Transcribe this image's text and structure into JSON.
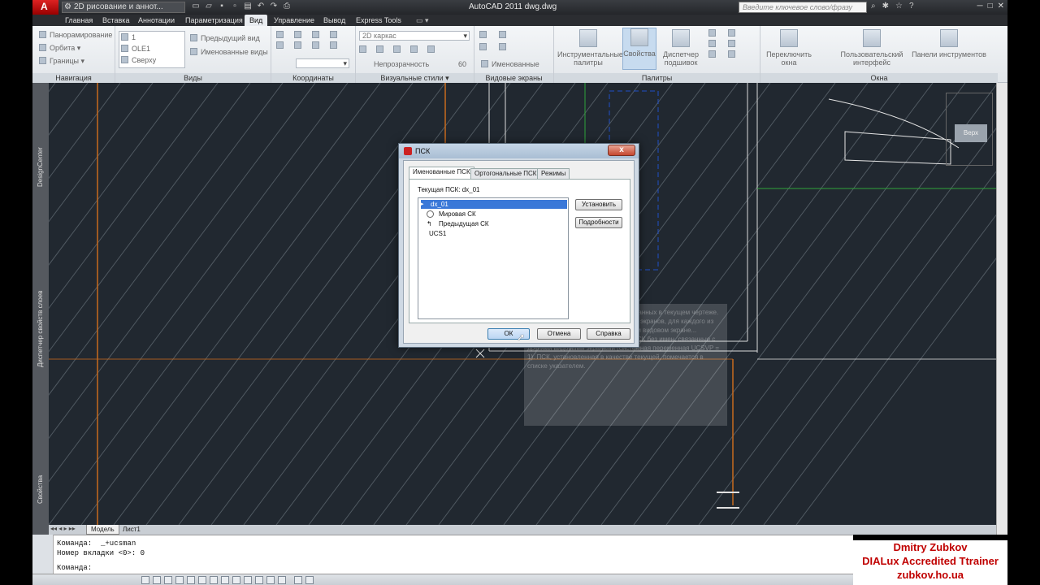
{
  "window": {
    "app_title": "AutoCAD 2011    dwg.dwg",
    "workspace": "2D рисование и аннот...",
    "search_placeholder": "Введите ключевое слово/фразу",
    "logo_letter": "A"
  },
  "menu_tabs": [
    "Главная",
    "Вставка",
    "Аннотации",
    "Параметризация",
    "Вид",
    "Управление",
    "Вывод",
    "Express Tools"
  ],
  "active_tab": "Вид",
  "ribbon": {
    "navigation": {
      "title": "Навигация",
      "items": [
        "Панорамирование",
        "Орбита ▾",
        "Границы ▾"
      ]
    },
    "views": {
      "title": "Виды",
      "list": [
        "1",
        "OLE1",
        "Сверху"
      ],
      "items": [
        "Предыдущий вид",
        "Именованные виды"
      ]
    },
    "coordinates": {
      "title": "Координаты"
    },
    "visual_styles": {
      "title": "Визуальные стили ▾",
      "style_combo": "2D каркас",
      "transparency_label": "Непрозрачность",
      "transparency_value": "60"
    },
    "viewports": {
      "title": "Видовые экраны",
      "named": "Именованные"
    },
    "palettes": {
      "title": "Палитры",
      "tool_palettes": [
        "Инструментальные",
        "палитры"
      ],
      "properties": "Свойства",
      "sheet_set": [
        "Диспетчер",
        "подшивок"
      ]
    },
    "windows": {
      "title": "Окна",
      "switch": [
        "Переключить",
        "окна"
      ],
      "user_interface": [
        "Пользовательский",
        "интерфейс"
      ],
      "toolbars": "Панели инструментов"
    }
  },
  "side_palettes": [
    "DesignCenter",
    "Диспетчер свойств слоев",
    "Свойства"
  ],
  "view_cube_label": "Верх",
  "layout_tabs": [
    "Модель",
    "Лист1"
  ],
  "command_line": {
    "line1": "Команда:  _+ucsman",
    "line2": "Номер вкладки <0>: 0",
    "prompt": "Команда:"
  },
  "tooltip": {
    "text": "Вывод списка систем координат, заданных в текущем чертеже. Если существует несколько видовых экранов, для каждого из них... Именованные ПСК... в текущем видовом экране... Приписанные ПСК... определения ПСК без имен, связанные с другими видовыми экранами (системная переменная UCSVP = 1). ПСК, установленная в качестве текущей, помечается в списке указателем."
  },
  "dialog": {
    "title": "ПСК",
    "close_glyph": "x",
    "tabs": [
      "Именованные ПСК",
      "Ортогональные ПСК",
      "Режимы"
    ],
    "active_tab": "Именованные ПСК",
    "current_label": "Текущая ПСК:  dx_01",
    "list": [
      {
        "label": "dx_01",
        "selected": true,
        "icon": "pointer-icon"
      },
      {
        "label": "Мировая СК",
        "selected": false,
        "icon": "world-icon"
      },
      {
        "label": "Предыдущая СК",
        "selected": false,
        "icon": "previous-icon"
      },
      {
        "label": "UCS1",
        "selected": false,
        "icon": ""
      }
    ],
    "set_current_button": "Установить",
    "details_button": "Подробности",
    "ok_button": "ОК",
    "cancel_button": "Отмена",
    "help_button": "Справка"
  },
  "watermark": {
    "line1": "Dmitry Zubkov",
    "line2": "DIALux Accredited Ttrainer",
    "line3": "zubkov.ho.ua"
  },
  "colors": {
    "drawing_bg": "#212830",
    "orange_line": "#c86a1e",
    "green_line": "#2fa53a",
    "blue_line": "#2050c8",
    "accent_selection": "#3a78d8",
    "watermark_text": "#c00000"
  }
}
